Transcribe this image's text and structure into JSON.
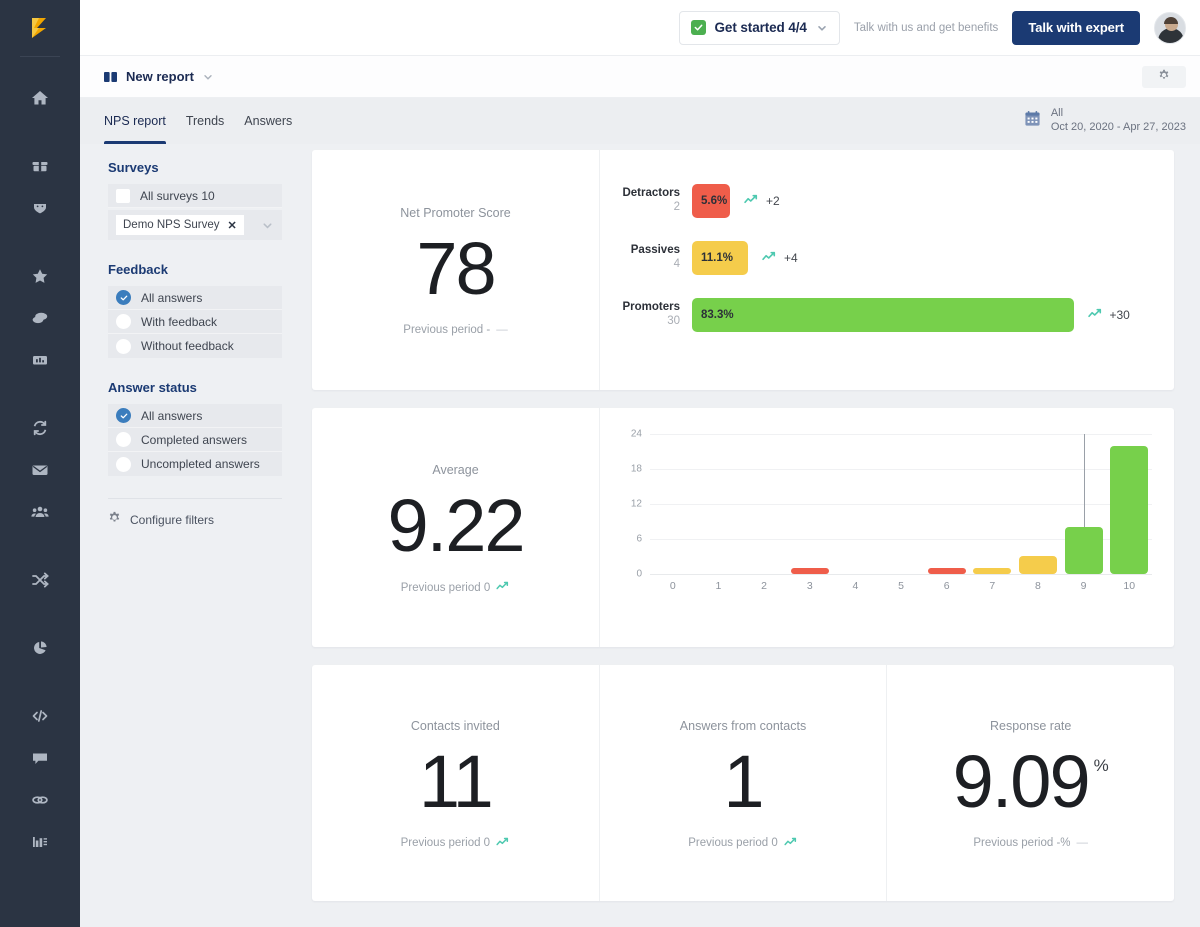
{
  "topbar": {
    "get_started_label": "Get started 4/4",
    "check_icon": "check-icon",
    "chevron_icon": "chevron-down-icon",
    "talk_note": "Talk with us and get benefits",
    "talk_button": "Talk with expert",
    "avatar": "user-avatar"
  },
  "reportbar": {
    "title": "New report",
    "book_icon": "report-icon",
    "chevron_icon": "chevron-down-icon",
    "gear_icon": "gear-icon"
  },
  "tabs": [
    {
      "label": "NPS report",
      "active": true
    },
    {
      "label": "Trends",
      "active": false
    },
    {
      "label": "Answers",
      "active": false
    }
  ],
  "daterange": {
    "calendar_icon": "calendar-icon",
    "label": "All",
    "range": "Oct 20, 2020 - Apr 27, 2023"
  },
  "filters": {
    "surveys": {
      "heading": "Surveys",
      "all_label": "All surveys 10",
      "chip_label": "Demo NPS Survey",
      "chip_close": "✕",
      "chevron_icon": "chevron-down-icon"
    },
    "feedback": {
      "heading": "Feedback",
      "options": [
        {
          "label": "All answers",
          "selected": true
        },
        {
          "label": "With feedback",
          "selected": false
        },
        {
          "label": "Without feedback",
          "selected": false
        }
      ]
    },
    "answer_status": {
      "heading": "Answer status",
      "options": [
        {
          "label": "All answers",
          "selected": true
        },
        {
          "label": "Completed answers",
          "selected": false
        },
        {
          "label": "Uncompleted answers",
          "selected": false
        }
      ]
    },
    "configure": {
      "label": "Configure filters",
      "icon": "gear-icon"
    }
  },
  "sidebar_icons": [
    "home-icon",
    "gift-icon",
    "ribbon-icon",
    "star-icon",
    "chat-bubbles-icon",
    "bar-chart-icon",
    "sync-icon",
    "envelope-icon",
    "people-icon",
    "shuffle-icon",
    "pie-chart-icon",
    "code-icon",
    "comment-icon",
    "link-icon",
    "report-list-icon"
  ],
  "cards": {
    "nps": {
      "title": "Net Promoter Score",
      "value": "78",
      "previous": "Previous period -",
      "previous_dash": "—"
    },
    "average": {
      "title": "Average",
      "value": "9.22",
      "previous": "Previous period 0",
      "trend_icon": "trend-up-icon"
    },
    "contacts_invited": {
      "title": "Contacts invited",
      "value": "11",
      "previous": "Previous period 0",
      "trend_icon": "trend-up-icon"
    },
    "answers_from_contacts": {
      "title": "Answers from contacts",
      "value": "1",
      "previous": "Previous period 0",
      "trend_icon": "trend-up-icon"
    },
    "response_rate": {
      "title": "Response rate",
      "value": "9.09",
      "suffix": "%",
      "previous": "Previous period -%",
      "previous_dash": "—"
    }
  },
  "colors": {
    "detractor": "#ef5d4a",
    "passive": "#f5cc4b",
    "promoter": "#77d04b",
    "trend": "#4ec9b0",
    "brand": "#1b3a73",
    "rail": "#2b3443"
  },
  "chart_data": [
    {
      "type": "bar",
      "orientation": "horizontal",
      "title": "NPS breakdown",
      "categories": [
        "Detractors",
        "Passives",
        "Promoters"
      ],
      "counts": [
        2,
        4,
        30
      ],
      "values": [
        5.6,
        11.1,
        83.3
      ],
      "value_labels": [
        "5.6%",
        "11.1%",
        "83.3%"
      ],
      "deltas": [
        "+2",
        "+4",
        "+30"
      ],
      "colors": [
        "#ef5d4a",
        "#f5cc4b",
        "#77d04b"
      ],
      "xlabel": "",
      "ylabel": "",
      "xlim": [
        0,
        100
      ]
    },
    {
      "type": "bar",
      "orientation": "vertical",
      "title": "Answer distribution",
      "categories": [
        "0",
        "1",
        "2",
        "3",
        "4",
        "5",
        "6",
        "7",
        "8",
        "9",
        "10"
      ],
      "values": [
        0,
        0,
        0,
        1,
        0,
        0,
        1,
        1,
        3,
        8,
        22
      ],
      "bar_colors": [
        "#ef5d4a",
        "#ef5d4a",
        "#ef5d4a",
        "#ef5d4a",
        "#ef5d4a",
        "#ef5d4a",
        "#ef5d4a",
        "#f5cc4b",
        "#f5cc4b",
        "#77d04b",
        "#77d04b"
      ],
      "yticks": [
        0,
        6,
        12,
        18,
        24
      ],
      "ylim": [
        0,
        24
      ],
      "xlabel": "",
      "ylabel": "",
      "grid": true,
      "marker_at_category": "9"
    }
  ]
}
